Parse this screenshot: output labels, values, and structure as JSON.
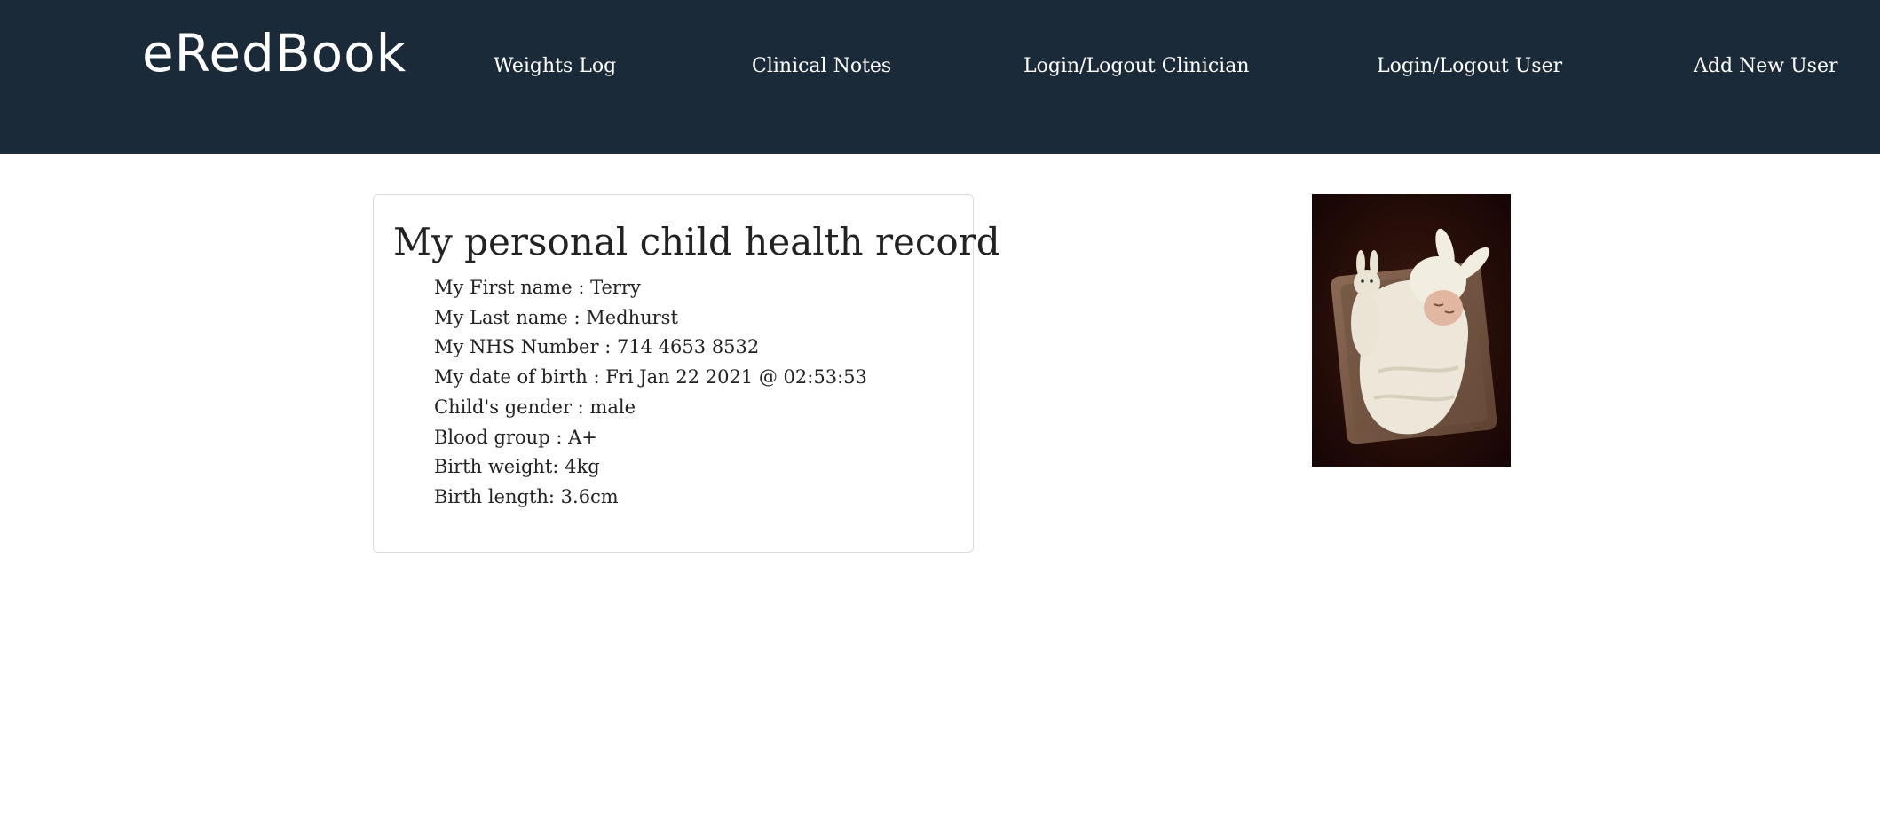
{
  "nav": {
    "brand": "eRedBook",
    "links": [
      {
        "label": "Weights Log"
      },
      {
        "label": "Clinical Notes"
      },
      {
        "label": "Login/Logout Clinician"
      },
      {
        "label": "Login/Logout User"
      },
      {
        "label": "Add New User"
      }
    ]
  },
  "record": {
    "title": "My personal child health record",
    "fields": [
      "My First name : Terry",
      "My Last name : Medhurst",
      "My NHS Number : 714 4653 8532",
      "My date of birth : Fri Jan 22 2021 @ 02:53:53",
      "Child's gender : male",
      "Blood group : A+",
      "Birth weight: 4kg",
      "Birth length: 3.6cm"
    ]
  },
  "colors": {
    "navbar_bg": "#1a2a38",
    "nav_text": "#ffffff",
    "body_text": "#222222",
    "card_border": "#dcdcdc"
  }
}
